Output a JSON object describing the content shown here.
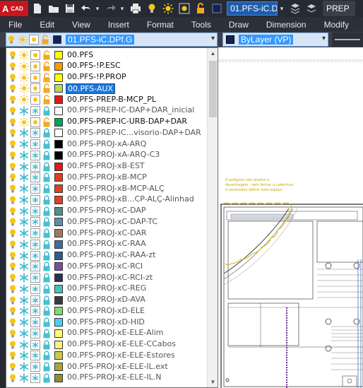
{
  "qat": {
    "logo_letter": "A",
    "logo_suffix": "CAD",
    "current_layer": "01.PFS-iC.D",
    "workspace": "PREP"
  },
  "menu": [
    "File",
    "Edit",
    "View",
    "Insert",
    "Format",
    "Tools",
    "Draw",
    "Dimension",
    "Modify"
  ],
  "layer_control": {
    "current_layer": "01.PFS-iC.DPf.G",
    "current_color": "#132257"
  },
  "properties": {
    "color_value": "ByLayer (VP)",
    "color_swatch": "#132257"
  },
  "layers": [
    {
      "name": "00.PFS",
      "color": "#ffff00",
      "frozen": false,
      "locked": false,
      "selected": false
    },
    {
      "name": "00.PFS-!P.ESC",
      "color": "#ff9900",
      "frozen": false,
      "locked": false,
      "selected": false
    },
    {
      "name": "00.PFS-!P.PROP",
      "color": "#ffff00",
      "frozen": false,
      "locked": false,
      "selected": false
    },
    {
      "name": "00.PFS-AUX",
      "color": "#b6d957",
      "frozen": false,
      "locked": false,
      "selected": true
    },
    {
      "name": "00.PFS-PREP-B-MCP_PL",
      "color": "#e21717",
      "frozen": false,
      "locked": false,
      "selected": false
    },
    {
      "name": "00.PFS-PREP-IC-DAP+DAR_inicial",
      "color": "#ffffff",
      "frozen": true,
      "locked": true,
      "selected": false
    },
    {
      "name": "00.PFS-PREP-IC-URB-DAP+DAR",
      "color": "#00a651",
      "frozen": false,
      "locked": false,
      "selected": false
    },
    {
      "name": "00.PFS-PREP-IC...visorio-DAP+DAR",
      "color": "#ffffff",
      "frozen": true,
      "locked": true,
      "selected": false
    },
    {
      "name": "00.PFS-PROJ-xA-ARQ",
      "color": "#000000",
      "frozen": true,
      "locked": true,
      "selected": false
    },
    {
      "name": "00.PFS-PROJ-xA-ARQ-C3",
      "color": "#000000",
      "frozen": true,
      "locked": true,
      "selected": false
    },
    {
      "name": "00.PFS-PROJ-xB-EST",
      "color": "#e21717",
      "frozen": true,
      "locked": true,
      "selected": false
    },
    {
      "name": "00.PFS-PROJ-xB-MCP",
      "color": "#e0401f",
      "frozen": true,
      "locked": true,
      "selected": false
    },
    {
      "name": "00.PFS-PROJ-xB-MCP-ALÇ",
      "color": "#e0401f",
      "frozen": true,
      "locked": true,
      "selected": false
    },
    {
      "name": "00.PFS-PROJ-xB...CP-ALÇ-Alinhad",
      "color": "#e0401f",
      "frozen": true,
      "locked": true,
      "selected": false
    },
    {
      "name": "00.PFS-PROJ-xC-DAP",
      "color": "#4e8f8c",
      "frozen": true,
      "locked": true,
      "selected": false
    },
    {
      "name": "00.PFS-PROJ-xC-DAP-TC",
      "color": "#5b8fa3",
      "frozen": true,
      "locked": true,
      "selected": false
    },
    {
      "name": "00.PFS-PROJ-xC-DAR",
      "color": "#a6785b",
      "frozen": true,
      "locked": true,
      "selected": false
    },
    {
      "name": "00.PFS-PROJ-xC-RAA",
      "color": "#3a6fa8",
      "frozen": true,
      "locked": true,
      "selected": false
    },
    {
      "name": "00.PFS-PROJ-xC-RAA-zt",
      "color": "#2e5c8f",
      "frozen": true,
      "locked": true,
      "selected": false
    },
    {
      "name": "00.PFS-PROJ-xC-RCI",
      "color": "#7a4ea1",
      "frozen": true,
      "locked": true,
      "selected": false
    },
    {
      "name": "00.PFS-PROJ-xC-RCI-zt",
      "color": "#2b2f55",
      "frozen": true,
      "locked": true,
      "selected": false
    },
    {
      "name": "00.PFS-PROJ-xC-REG",
      "color": "#44c5b4",
      "frozen": true,
      "locked": true,
      "selected": false
    },
    {
      "name": "00.PFS-PROJ-xD-AVA",
      "color": "#3b3b3b",
      "frozen": true,
      "locked": true,
      "selected": false
    },
    {
      "name": "00.PFS-PROJ-xD-ELE",
      "color": "#7ddc6a",
      "frozen": true,
      "locked": true,
      "selected": false
    },
    {
      "name": "00.PFS-PROJ-xD-HID",
      "color": "#49d2ef",
      "frozen": true,
      "locked": true,
      "selected": false
    },
    {
      "name": "00.PFS-PROJ-xE-ELE-Alim",
      "color": "#ffff66",
      "frozen": true,
      "locked": true,
      "selected": false
    },
    {
      "name": "00.PFS-PROJ-xE-ELE-CCabos",
      "color": "#f7f37a",
      "frozen": true,
      "locked": true,
      "selected": false
    },
    {
      "name": "00.PFS-PROJ-xE-ELE-Estores",
      "color": "#c9c94a",
      "frozen": true,
      "locked": true,
      "selected": false
    },
    {
      "name": "00.PFS-PROJ-xE-ELE-IL.ext",
      "color": "#a8a832",
      "frozen": true,
      "locked": true,
      "selected": false
    },
    {
      "name": "00.PFS-PROJ-xE-ELE-IL.N",
      "color": "#8f8f2b",
      "frozen": true,
      "locked": true,
      "selected": false
    }
  ],
  "drawing": {
    "note_lines": [
      "O polígono não resolve a",
      "desenhagem - sem fechar a cobertura",
      "é necessário definir este espaço"
    ]
  }
}
